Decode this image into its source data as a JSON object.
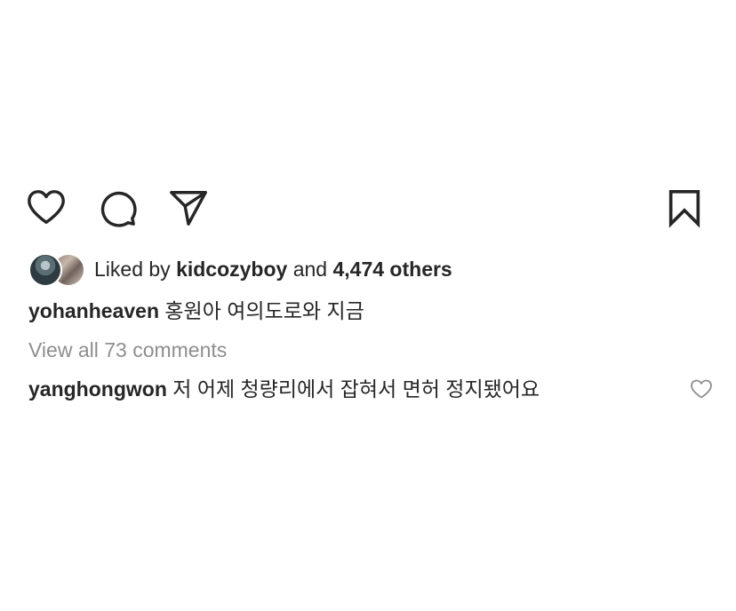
{
  "actions": {
    "like_icon": "heart-outline",
    "comment_icon": "speech-bubble-outline",
    "share_icon": "paper-plane-outline",
    "save_icon": "bookmark-outline"
  },
  "likes": {
    "prefix": "Liked by",
    "user": "kidcozyboy",
    "middle": "and",
    "others": "4,474 others"
  },
  "caption": {
    "username": "yohanheaven",
    "text": "홍원아 여의도로와 지금"
  },
  "comments_link": "View all 73 comments",
  "comment": {
    "username": "yanghongwon",
    "text": "저 어제 청량리에서 잡혀서 면허 정지됐어요",
    "like_icon": "heart-outline-small"
  },
  "colors": {
    "text": "#262626",
    "muted": "#8e8e8e",
    "background": "#ffffff"
  }
}
